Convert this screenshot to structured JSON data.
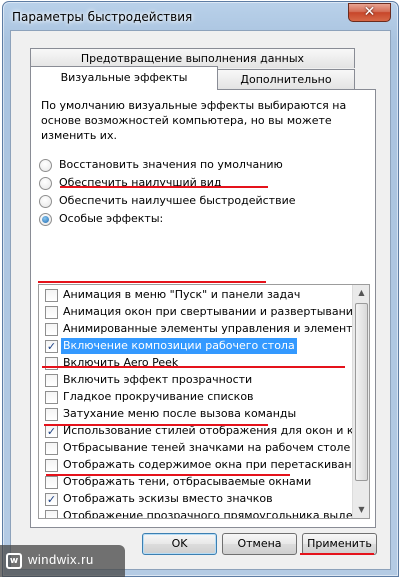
{
  "window": {
    "title": "Параметры быстродействия",
    "close_glyph": "✕"
  },
  "tabs": {
    "top": "Предотвращение выполнения данных",
    "active": "Визуальные эффекты",
    "other": "Дополнительно"
  },
  "description": "По умолчанию визуальные эффекты выбираются на основе возможностей компьютера, но вы можете изменить их.",
  "radios": [
    {
      "label": "Восстановить значения по умолчанию",
      "checked": false
    },
    {
      "label": "Обеспечить наилучший вид",
      "checked": false
    },
    {
      "label": "Обеспечить наилучшее быстродействие",
      "checked": false
    },
    {
      "label": "Особые эффекты:",
      "checked": true
    }
  ],
  "effects": [
    {
      "label": "Анимация в меню \"Пуск\" и панели задач",
      "checked": false,
      "selected": false
    },
    {
      "label": "Анимация окон при свертывании и развертывании",
      "checked": false,
      "selected": false
    },
    {
      "label": "Анимированные элементы управления и элементы внутри",
      "checked": false,
      "selected": false
    },
    {
      "label": "Включение композиции рабочего стола",
      "checked": true,
      "selected": true
    },
    {
      "label": "Включить Aero Peek",
      "checked": false,
      "selected": false
    },
    {
      "label": "Включить эффект прозрачности",
      "checked": false,
      "selected": false
    },
    {
      "label": "Гладкое прокручивание списков",
      "checked": false,
      "selected": false
    },
    {
      "label": "Затухание меню после вызова команды",
      "checked": false,
      "selected": false
    },
    {
      "label": "Использование стилей отображения для окон и кнопок",
      "checked": true,
      "selected": false
    },
    {
      "label": "Отбрасывание теней значками на рабочем столе",
      "checked": false,
      "selected": false
    },
    {
      "label": "Отображать содержимое окна при перетаскивании",
      "checked": false,
      "selected": false
    },
    {
      "label": "Отображать тени, отбрасываемые окнами",
      "checked": false,
      "selected": false
    },
    {
      "label": "Отображать эскизы вместо значков",
      "checked": true,
      "selected": false
    },
    {
      "label": "Отображение прозрачного прямоугольника выделения",
      "checked": false,
      "selected": false
    },
    {
      "label": "Отображение тени под указателем мыши",
      "checked": false,
      "selected": false
    },
    {
      "label": "Сглаживать неровности экранных шрифтов",
      "checked": true,
      "selected": false
    },
    {
      "label": "Скольжение при раскрытии списков",
      "checked": false,
      "selected": false
    }
  ],
  "checkmark_glyph": "✓",
  "buttons": {
    "ok": "OK",
    "cancel": "Отмена",
    "apply": "Применить"
  },
  "watermark": {
    "text": "windwix.ru",
    "icon_glyph": "w"
  },
  "colors": {
    "annotation_underline": "#e5121b",
    "selection": "#3399ff"
  }
}
